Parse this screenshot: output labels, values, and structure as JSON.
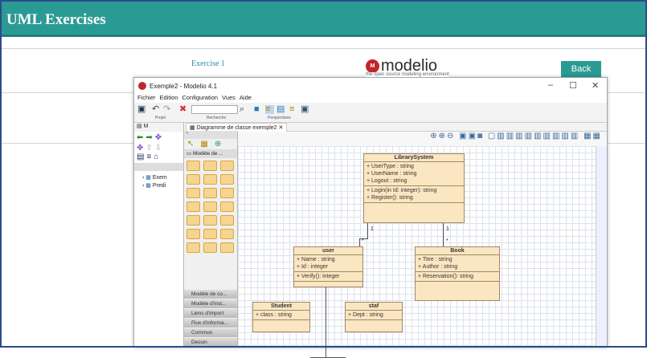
{
  "page": {
    "title": "UML Exercises",
    "exercise": "Exercise 1",
    "back": "Back",
    "logo": "modelio",
    "logo_tag": "the open source modeling environment",
    "colors": {
      "teal": "#2a9b94"
    }
  },
  "window": {
    "title": "Exemple2 - Modelio 4.1",
    "menu": [
      "Fichier",
      "Edition",
      "Configuration",
      "Vues",
      "Aide"
    ],
    "groups": [
      "Projet",
      "Recherche",
      "Perspectives"
    ],
    "left_tab": "M",
    "tree": [
      "Exem",
      "Predi"
    ],
    "diagram_tab": "Diagramme de classe exemple2",
    "palette_header": "Modèle de ...",
    "palette_categories": [
      "Modèle de co...",
      "Modèle d'inst...",
      "Liens d'import",
      "Flux d'informa...",
      "Commun",
      "Dessin"
    ]
  },
  "diagram": {
    "classes": [
      {
        "name": "LibrarySystem",
        "attributes": [
          "+ UserType : string",
          "+ UserName : string",
          "+ Logout : string"
        ],
        "operations": [
          "+ Login(in Id: integer): string",
          "+ Register(): string"
        ]
      },
      {
        "name": "user",
        "attributes": [
          "+ Name : string",
          "+ Id : integer"
        ],
        "operations": [
          "+ Verify(): integer"
        ]
      },
      {
        "name": "Book",
        "attributes": [
          "+ Titre : string",
          "+ Author : string"
        ],
        "operations": [
          "+ Reservation(): string"
        ]
      },
      {
        "name": "Student",
        "attributes": [
          "+ class : string"
        ],
        "operations": []
      },
      {
        "name": "staf",
        "attributes": [
          "+ Dept : string"
        ],
        "operations": []
      }
    ],
    "multiplicities": {
      "one": "1",
      "many": "*"
    }
  }
}
